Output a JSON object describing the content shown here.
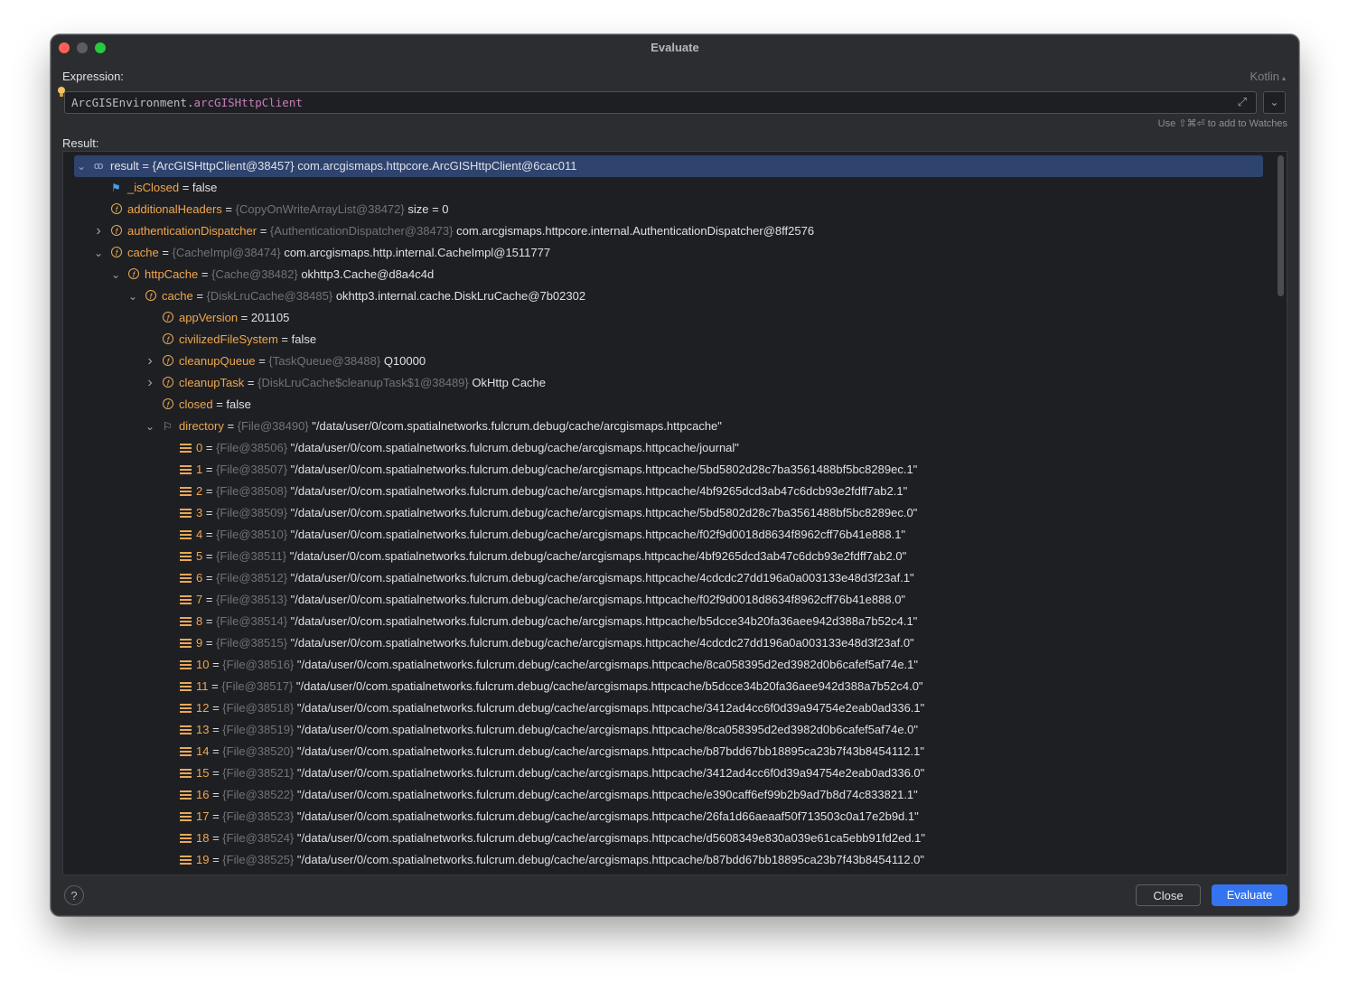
{
  "window": {
    "title": "Evaluate"
  },
  "expression": {
    "label": "Expression:",
    "language": "Kotlin",
    "value_receiver": "ArcGISEnvironment",
    "value_dot": ".",
    "value_property": "arcGISHttpClient",
    "hint": "Use ⇧⌘⏎ to add to Watches"
  },
  "result": {
    "label": "Result:",
    "rows": [
      {
        "depth": 0,
        "arrow": "expanded",
        "icon": "watch",
        "name": "result",
        "eq": " = ",
        "type": "{ArcGISHttpClient@38457}",
        "value": " com.arcgismaps.httpcore.ArcGISHttpClient@6cac011",
        "selected": true,
        "white": true
      },
      {
        "depth": 1,
        "arrow": "none",
        "icon": "flag",
        "name": "_isClosed",
        "eq": " = ",
        "type": "",
        "value": "false"
      },
      {
        "depth": 1,
        "arrow": "none",
        "icon": "field",
        "name": "additionalHeaders",
        "eq": " = ",
        "type": "{CopyOnWriteArrayList@38472}",
        "value": "  size = 0"
      },
      {
        "depth": 1,
        "arrow": "collapsed",
        "icon": "field",
        "name": "authenticationDispatcher",
        "eq": " = ",
        "type": "{AuthenticationDispatcher@38473}",
        "value": " com.arcgismaps.httpcore.internal.AuthenticationDispatcher@8ff2576"
      },
      {
        "depth": 1,
        "arrow": "expanded",
        "icon": "field",
        "name": "cache",
        "eq": " = ",
        "type": "{CacheImpl@38474}",
        "value": " com.arcgismaps.http.internal.CacheImpl@1511777"
      },
      {
        "depth": 2,
        "arrow": "expanded",
        "icon": "field",
        "name": "httpCache",
        "eq": " = ",
        "type": "{Cache@38482}",
        "value": " okhttp3.Cache@d8a4c4d"
      },
      {
        "depth": 3,
        "arrow": "expanded",
        "icon": "field",
        "name": "cache",
        "eq": " = ",
        "type": "{DiskLruCache@38485}",
        "value": " okhttp3.internal.cache.DiskLruCache@7b02302"
      },
      {
        "depth": 4,
        "arrow": "none",
        "icon": "field",
        "name": "appVersion",
        "eq": " = ",
        "type": "",
        "value": "201105"
      },
      {
        "depth": 4,
        "arrow": "none",
        "icon": "field",
        "name": "civilizedFileSystem",
        "eq": " = ",
        "type": "",
        "value": "false"
      },
      {
        "depth": 4,
        "arrow": "collapsed",
        "icon": "field",
        "name": "cleanupQueue",
        "eq": " = ",
        "type": "{TaskQueue@38488}",
        "value": " Q10000"
      },
      {
        "depth": 4,
        "arrow": "collapsed",
        "icon": "field",
        "name": "cleanupTask",
        "eq": " = ",
        "type": "{DiskLruCache$cleanupTask$1@38489}",
        "value": " OkHttp Cache"
      },
      {
        "depth": 4,
        "arrow": "none",
        "icon": "field",
        "name": "closed",
        "eq": " = ",
        "type": "",
        "value": "false"
      },
      {
        "depth": 4,
        "arrow": "expanded",
        "icon": "flag2",
        "name": "directory",
        "eq": " = ",
        "type": "{File@38490}",
        "value": " \"/data/user/0/com.spatialnetworks.fulcrum.debug/cache/arcgismaps.httpcache\""
      },
      {
        "depth": 5,
        "arrow": "none",
        "icon": "array",
        "name": "0",
        "eq": " = ",
        "type": "{File@38506}",
        "value": " \"/data/user/0/com.spatialnetworks.fulcrum.debug/cache/arcgismaps.httpcache/journal\""
      },
      {
        "depth": 5,
        "arrow": "none",
        "icon": "array",
        "name": "1",
        "eq": " = ",
        "type": "{File@38507}",
        "value": " \"/data/user/0/com.spatialnetworks.fulcrum.debug/cache/arcgismaps.httpcache/5bd5802d28c7ba3561488bf5bc8289ec.1\""
      },
      {
        "depth": 5,
        "arrow": "none",
        "icon": "array",
        "name": "2",
        "eq": " = ",
        "type": "{File@38508}",
        "value": " \"/data/user/0/com.spatialnetworks.fulcrum.debug/cache/arcgismaps.httpcache/4bf9265dcd3ab47c6dcb93e2fdff7ab2.1\""
      },
      {
        "depth": 5,
        "arrow": "none",
        "icon": "array",
        "name": "3",
        "eq": " = ",
        "type": "{File@38509}",
        "value": " \"/data/user/0/com.spatialnetworks.fulcrum.debug/cache/arcgismaps.httpcache/5bd5802d28c7ba3561488bf5bc8289ec.0\""
      },
      {
        "depth": 5,
        "arrow": "none",
        "icon": "array",
        "name": "4",
        "eq": " = ",
        "type": "{File@38510}",
        "value": " \"/data/user/0/com.spatialnetworks.fulcrum.debug/cache/arcgismaps.httpcache/f02f9d0018d8634f8962cff76b41e888.1\""
      },
      {
        "depth": 5,
        "arrow": "none",
        "icon": "array",
        "name": "5",
        "eq": " = ",
        "type": "{File@38511}",
        "value": " \"/data/user/0/com.spatialnetworks.fulcrum.debug/cache/arcgismaps.httpcache/4bf9265dcd3ab47c6dcb93e2fdff7ab2.0\""
      },
      {
        "depth": 5,
        "arrow": "none",
        "icon": "array",
        "name": "6",
        "eq": " = ",
        "type": "{File@38512}",
        "value": " \"/data/user/0/com.spatialnetworks.fulcrum.debug/cache/arcgismaps.httpcache/4cdcdc27dd196a0a003133e48d3f23af.1\""
      },
      {
        "depth": 5,
        "arrow": "none",
        "icon": "array",
        "name": "7",
        "eq": " = ",
        "type": "{File@38513}",
        "value": " \"/data/user/0/com.spatialnetworks.fulcrum.debug/cache/arcgismaps.httpcache/f02f9d0018d8634f8962cff76b41e888.0\""
      },
      {
        "depth": 5,
        "arrow": "none",
        "icon": "array",
        "name": "8",
        "eq": " = ",
        "type": "{File@38514}",
        "value": " \"/data/user/0/com.spatialnetworks.fulcrum.debug/cache/arcgismaps.httpcache/b5dcce34b20fa36aee942d388a7b52c4.1\""
      },
      {
        "depth": 5,
        "arrow": "none",
        "icon": "array",
        "name": "9",
        "eq": " = ",
        "type": "{File@38515}",
        "value": " \"/data/user/0/com.spatialnetworks.fulcrum.debug/cache/arcgismaps.httpcache/4cdcdc27dd196a0a003133e48d3f23af.0\""
      },
      {
        "depth": 5,
        "arrow": "none",
        "icon": "array",
        "name": "10",
        "eq": " = ",
        "type": "{File@38516}",
        "value": " \"/data/user/0/com.spatialnetworks.fulcrum.debug/cache/arcgismaps.httpcache/8ca058395d2ed3982d0b6cafef5af74e.1\""
      },
      {
        "depth": 5,
        "arrow": "none",
        "icon": "array",
        "name": "11",
        "eq": " = ",
        "type": "{File@38517}",
        "value": " \"/data/user/0/com.spatialnetworks.fulcrum.debug/cache/arcgismaps.httpcache/b5dcce34b20fa36aee942d388a7b52c4.0\""
      },
      {
        "depth": 5,
        "arrow": "none",
        "icon": "array",
        "name": "12",
        "eq": " = ",
        "type": "{File@38518}",
        "value": " \"/data/user/0/com.spatialnetworks.fulcrum.debug/cache/arcgismaps.httpcache/3412ad4cc6f0d39a94754e2eab0ad336.1\""
      },
      {
        "depth": 5,
        "arrow": "none",
        "icon": "array",
        "name": "13",
        "eq": " = ",
        "type": "{File@38519}",
        "value": " \"/data/user/0/com.spatialnetworks.fulcrum.debug/cache/arcgismaps.httpcache/8ca058395d2ed3982d0b6cafef5af74e.0\""
      },
      {
        "depth": 5,
        "arrow": "none",
        "icon": "array",
        "name": "14",
        "eq": " = ",
        "type": "{File@38520}",
        "value": " \"/data/user/0/com.spatialnetworks.fulcrum.debug/cache/arcgismaps.httpcache/b87bdd67bb18895ca23b7f43b8454112.1\""
      },
      {
        "depth": 5,
        "arrow": "none",
        "icon": "array",
        "name": "15",
        "eq": " = ",
        "type": "{File@38521}",
        "value": " \"/data/user/0/com.spatialnetworks.fulcrum.debug/cache/arcgismaps.httpcache/3412ad4cc6f0d39a94754e2eab0ad336.0\""
      },
      {
        "depth": 5,
        "arrow": "none",
        "icon": "array",
        "name": "16",
        "eq": " = ",
        "type": "{File@38522}",
        "value": " \"/data/user/0/com.spatialnetworks.fulcrum.debug/cache/arcgismaps.httpcache/e390caff6ef99b2b9ad7b8d74c833821.1\""
      },
      {
        "depth": 5,
        "arrow": "none",
        "icon": "array",
        "name": "17",
        "eq": " = ",
        "type": "{File@38523}",
        "value": " \"/data/user/0/com.spatialnetworks.fulcrum.debug/cache/arcgismaps.httpcache/26fa1d66aeaaf50f713503c0a17e2b9d.1\""
      },
      {
        "depth": 5,
        "arrow": "none",
        "icon": "array",
        "name": "18",
        "eq": " = ",
        "type": "{File@38524}",
        "value": " \"/data/user/0/com.spatialnetworks.fulcrum.debug/cache/arcgismaps.httpcache/d5608349e830a039e61ca5ebb91fd2ed.1\""
      },
      {
        "depth": 5,
        "arrow": "none",
        "icon": "array",
        "name": "19",
        "eq": " = ",
        "type": "{File@38525}",
        "value": " \"/data/user/0/com.spatialnetworks.fulcrum.debug/cache/arcgismaps.httpcache/b87bdd67bb18895ca23b7f43b8454112.0\""
      }
    ]
  },
  "footer": {
    "help": "?",
    "close_label": "Close",
    "evaluate_label": "Evaluate"
  },
  "colors": {
    "background": "#2b2d30",
    "field_name": "#f0a64e",
    "type_hint": "#6f737a",
    "selection": "#2e436e",
    "primary_button": "#3574f0"
  }
}
